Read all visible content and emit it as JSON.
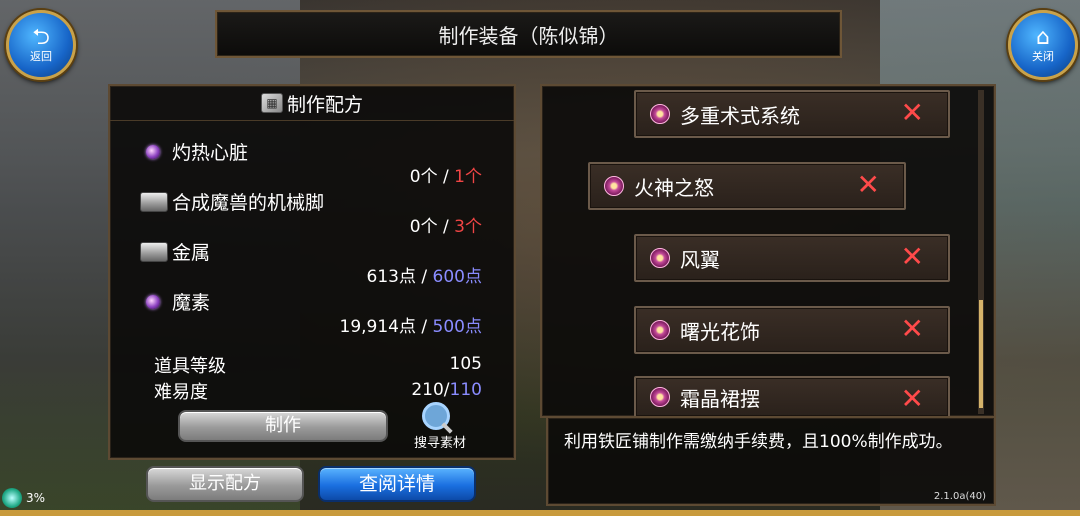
{
  "top_buttons": {
    "back": {
      "label": "返回",
      "icon": "return-arrow-icon"
    },
    "close": {
      "label": "关闭",
      "icon": "home-icon"
    }
  },
  "window_title": "制作装备（陈似锦）",
  "recipe": {
    "header": "制作配方",
    "materials": [
      {
        "name": "灼热心脏",
        "icon": "magic-orb-icon",
        "have": "0个",
        "sep": " / ",
        "need": "1个"
      },
      {
        "name": "合成魔兽的机械脚",
        "icon": "metal-ingot-icon",
        "have": "0个",
        "sep": " / ",
        "need": "3个"
      },
      {
        "name": "金属",
        "icon": "metal-ingot-icon",
        "have": "613点",
        "sep": " / ",
        "need": "600点"
      },
      {
        "name": "魔素",
        "icon": "magic-orb-icon",
        "have": "19,914点",
        "sep": " / ",
        "need": "500点"
      }
    ],
    "item_level_label": "道具等级",
    "item_level_value": "105",
    "difficulty_label": "难易度",
    "difficulty_have": "210/",
    "difficulty_need": "110",
    "craft_button": "制作",
    "search_materials": "搜寻素材"
  },
  "bottom_buttons": {
    "show_recipe": "显示配方",
    "view_details": "查阅详情"
  },
  "equipment_list": [
    {
      "name": "多重术式系统"
    },
    {
      "name": "火神之怒"
    },
    {
      "name": "风翼"
    },
    {
      "name": "曙光花饰"
    },
    {
      "name": "霜晶裙摆"
    }
  ],
  "description": "利用铁匠铺制作需缴纳手续费，且100%制作成功。",
  "version": "2.1.0a(40)",
  "status_percent": "3%",
  "colors": {
    "need_red": "#f04545",
    "need_blue": "#8a8cff",
    "remove_x": "#ff4a4a",
    "frame_gold": "#c89a3c"
  }
}
